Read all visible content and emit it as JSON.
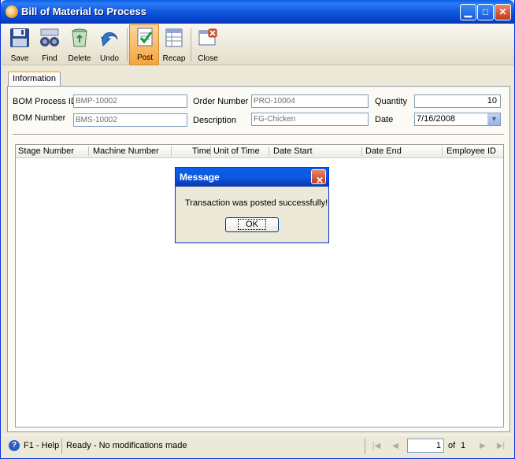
{
  "window": {
    "title": "Bill of Material to Process",
    "min_glyph": "▁",
    "max_glyph": "□",
    "close_glyph": "✕"
  },
  "toolbar": {
    "save": "Save",
    "find": "Find",
    "delete": "Delete",
    "undo": "Undo",
    "post": "Post",
    "recap": "Recap",
    "close": "Close"
  },
  "tabs": {
    "information": "Information"
  },
  "form": {
    "bom_process_id_label": "BOM Process ID",
    "bom_process_id": "BMP-10002",
    "bom_number_label": "BOM Number",
    "bom_number": "BMS-10002",
    "order_number_label": "Order Number",
    "order_number": "PRO-10004",
    "description_label": "Description",
    "description": "FG-Chicken",
    "quantity_label": "Quantity",
    "quantity": "10",
    "date_label": "Date",
    "date": "7/16/2008"
  },
  "grid": {
    "columns": [
      "Stage Number",
      "Machine Number",
      "Time",
      "Unit of Time",
      "Date Start",
      "Date End",
      "Employee ID"
    ]
  },
  "dialog": {
    "title": "Message",
    "message": "Transaction was posted successfully!",
    "ok": "OK"
  },
  "status": {
    "help": "F1 - Help",
    "text": "Ready - No modifications made",
    "page": "1",
    "of": "of",
    "total": "1"
  },
  "colors": {
    "title_bar": "#0A5FE8",
    "active_tool": "#F5A43E",
    "face": "#ECE9D8"
  }
}
